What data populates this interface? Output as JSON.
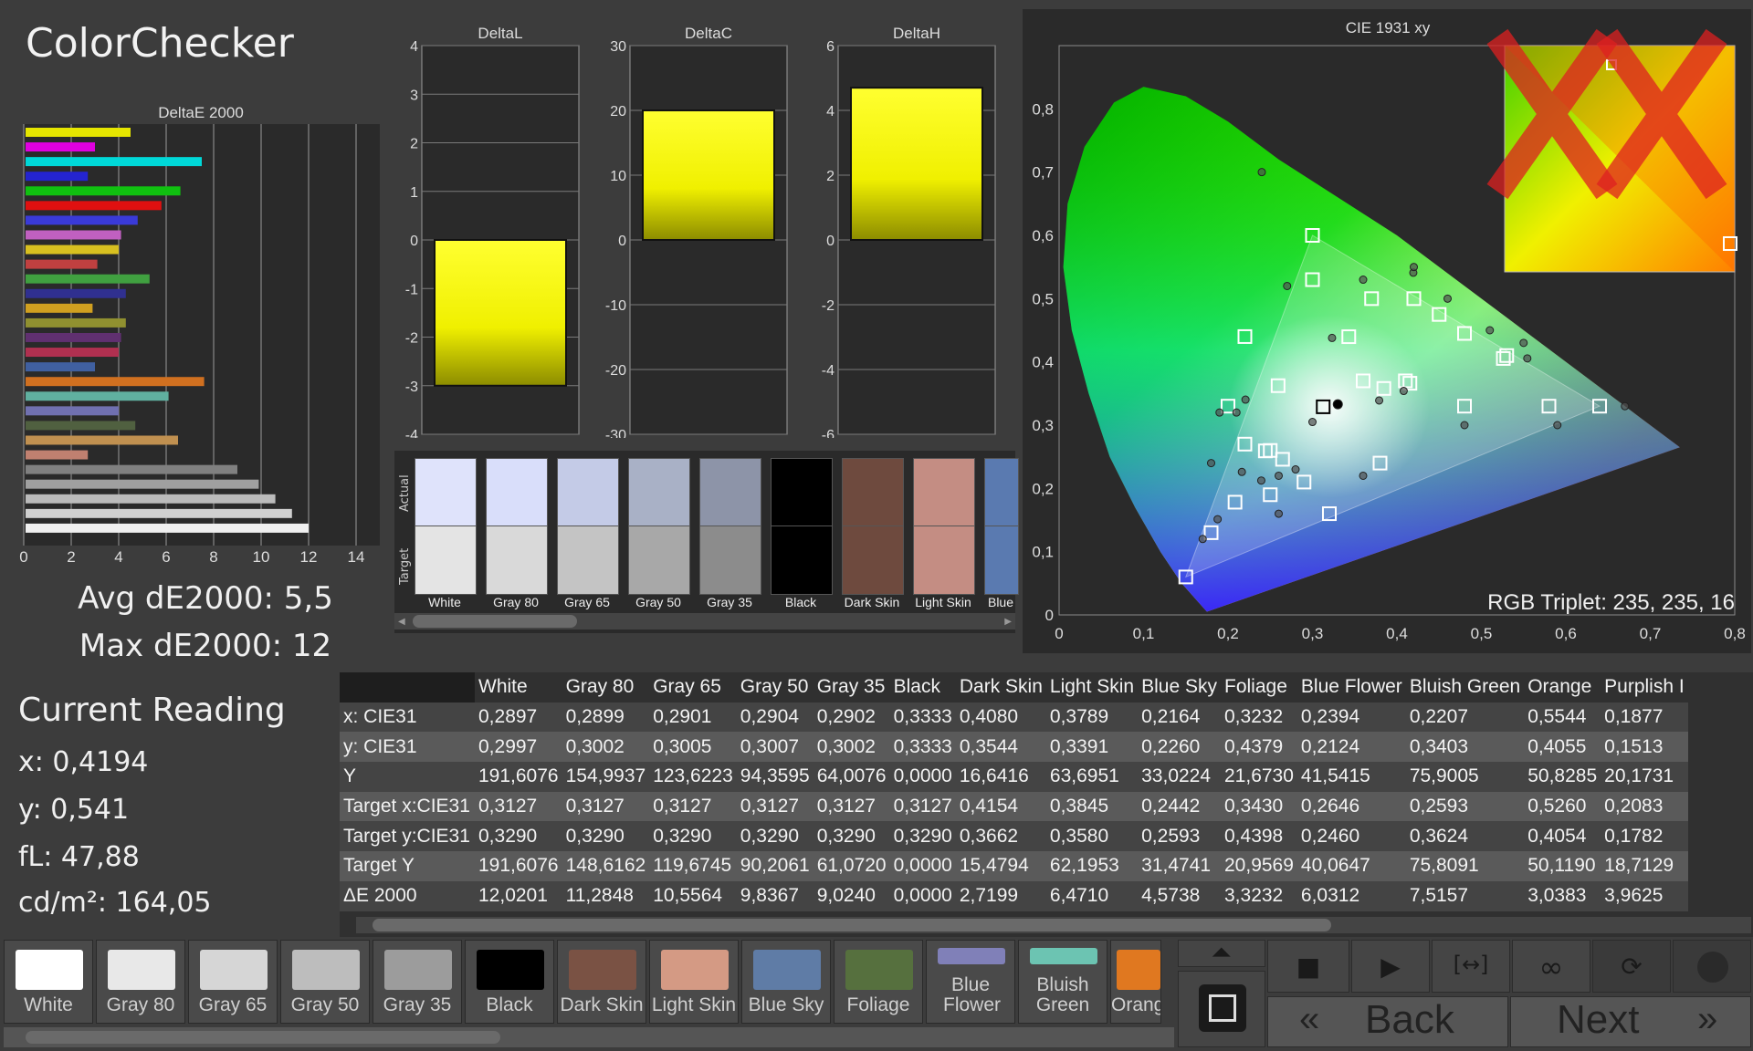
{
  "app": {
    "title": "ColorChecker",
    "avg_label": "Avg dE2000: 5,5",
    "max_label": "Max dE2000: 12"
  },
  "current_reading": {
    "title": "Current Reading",
    "x": "x: 0,4194",
    "y": "y: 0,541",
    "fL": "fL: 47,88",
    "cdm2": "cd/m²: 164,05"
  },
  "charts": {
    "deltaE": {
      "title": "DeltaE 2000"
    },
    "deltaL": {
      "title": "DeltaL"
    },
    "deltaC": {
      "title": "DeltaC"
    },
    "deltaH": {
      "title": "DeltaH"
    },
    "cie": {
      "title": "CIE 1931 xy",
      "rgb_triplet": "RGB Triplet: 235, 235, 16"
    }
  },
  "chart_data": [
    {
      "type": "bar",
      "title": "DeltaE 2000",
      "orientation": "horizontal",
      "xlim": [
        0,
        15
      ],
      "xticks": [
        "0",
        "2",
        "4",
        "6",
        "8",
        "10",
        "12",
        "14"
      ],
      "values": [
        4.5,
        3.0,
        7.5,
        2.7,
        6.6,
        5.8,
        4.8,
        4.1,
        4.0,
        3.1,
        5.3,
        4.3,
        2.9,
        4.3,
        4.1,
        4.0,
        3.0,
        7.6,
        6.1,
        4.0,
        4.7,
        6.5,
        2.7,
        9.0,
        9.9,
        10.6,
        11.3,
        12.0
      ],
      "colors": [
        "#e6e600",
        "#e000e0",
        "#00d8d8",
        "#2424d0",
        "#10c010",
        "#e01010",
        "#3a3ad8",
        "#c060c0",
        "#d8c020",
        "#c04040",
        "#40a040",
        "#303090",
        "#d0a020",
        "#909030",
        "#603070",
        "#b03050",
        "#4060a0",
        "#d07020",
        "#60b0a0",
        "#7070b0",
        "#506040",
        "#c09050",
        "#c08070",
        "#808080",
        "#a0a0a0",
        "#bbbbbb",
        "#d0d0d0",
        "#f0f0f0"
      ]
    },
    {
      "type": "bar",
      "title": "DeltaL",
      "values": [
        -3.0
      ],
      "ylim": [
        -4,
        4
      ],
      "yticks": [
        "4",
        "3",
        "2",
        "1",
        "0",
        "-1",
        "-2",
        "-3",
        "-4"
      ]
    },
    {
      "type": "bar",
      "title": "DeltaC",
      "values": [
        20
      ],
      "ylim": [
        -30,
        30
      ],
      "yticks": [
        "30",
        "20",
        "10",
        "0",
        "-10",
        "-20",
        "-30"
      ]
    },
    {
      "type": "bar",
      "title": "DeltaH",
      "values": [
        4.7
      ],
      "ylim": [
        -6,
        6
      ],
      "yticks": [
        "6",
        "4",
        "2",
        "0",
        "-2",
        "-4",
        "-6"
      ]
    },
    {
      "type": "scatter",
      "title": "CIE 1931 xy",
      "xlim": [
        0,
        0.8
      ],
      "ylim": [
        0,
        0.9
      ],
      "xticks": [
        "0",
        "0,1",
        "0,2",
        "0,3",
        "0,4",
        "0,5",
        "0,6",
        "0,7",
        "0,8"
      ],
      "yticks": [
        "0",
        "0,1",
        "0,2",
        "0,3",
        "0,4",
        "0,5",
        "0,6",
        "0,7",
        "0,8"
      ],
      "gamut": [
        [
          0.64,
          0.33
        ],
        [
          0.3,
          0.6
        ],
        [
          0.15,
          0.06
        ]
      ],
      "targets": [
        [
          0.3127,
          0.329
        ],
        [
          0.64,
          0.33
        ],
        [
          0.3,
          0.6
        ],
        [
          0.15,
          0.06
        ],
        [
          0.4154,
          0.3662
        ],
        [
          0.3845,
          0.358
        ],
        [
          0.2442,
          0.2593
        ],
        [
          0.343,
          0.4398
        ],
        [
          0.2646,
          0.246
        ],
        [
          0.2593,
          0.3624
        ],
        [
          0.526,
          0.4054
        ],
        [
          0.2083,
          0.1782
        ],
        [
          0.2,
          0.33
        ],
        [
          0.22,
          0.44
        ],
        [
          0.3,
          0.53
        ],
        [
          0.37,
          0.5
        ],
        [
          0.42,
          0.5
        ],
        [
          0.45,
          0.475
        ],
        [
          0.48,
          0.445
        ],
        [
          0.53,
          0.41
        ],
        [
          0.58,
          0.33
        ],
        [
          0.36,
          0.37
        ],
        [
          0.41,
          0.37
        ],
        [
          0.48,
          0.33
        ],
        [
          0.38,
          0.24
        ],
        [
          0.22,
          0.27
        ],
        [
          0.25,
          0.26
        ],
        [
          0.25,
          0.19
        ],
        [
          0.29,
          0.21
        ],
        [
          0.32,
          0.16
        ],
        [
          0.18,
          0.13
        ]
      ],
      "measured": [
        [
          0.4194,
          0.541
        ],
        [
          0.33,
          0.333
        ],
        [
          0.408,
          0.354
        ],
        [
          0.379,
          0.339
        ],
        [
          0.2164,
          0.226
        ],
        [
          0.3232,
          0.4379
        ],
        [
          0.2394,
          0.2124
        ],
        [
          0.2207,
          0.3403
        ],
        [
          0.5544,
          0.4055
        ],
        [
          0.1877,
          0.1513
        ],
        [
          0.24,
          0.7
        ],
        [
          0.27,
          0.52
        ],
        [
          0.36,
          0.53
        ],
        [
          0.42,
          0.55
        ],
        [
          0.46,
          0.5
        ],
        [
          0.51,
          0.45
        ],
        [
          0.55,
          0.43
        ],
        [
          0.67,
          0.33
        ],
        [
          0.59,
          0.3
        ],
        [
          0.48,
          0.3
        ],
        [
          0.3,
          0.305
        ],
        [
          0.19,
          0.32
        ],
        [
          0.21,
          0.32
        ],
        [
          0.26,
          0.22
        ],
        [
          0.28,
          0.23
        ],
        [
          0.26,
          0.16
        ],
        [
          0.36,
          0.22
        ],
        [
          0.18,
          0.24
        ],
        [
          0.17,
          0.12
        ]
      ]
    }
  ],
  "swatch_strip": {
    "actual_label": "Actual",
    "target_label": "Target",
    "items": [
      {
        "label": "White",
        "actual": "#dfe3fb",
        "target": "#e4e4e4"
      },
      {
        "label": "Gray 80",
        "actual": "#d9defa",
        "target": "#d9d9d9"
      },
      {
        "label": "Gray 65",
        "actual": "#c4cbe7",
        "target": "#c4c4c4"
      },
      {
        "label": "Gray 50",
        "actual": "#a9b1c6",
        "target": "#a8a8a8"
      },
      {
        "label": "Gray 35",
        "actual": "#8d94a8",
        "target": "#8c8c8c"
      },
      {
        "label": "Black",
        "actual": "#000000",
        "target": "#000000"
      },
      {
        "label": "Dark Skin",
        "actual": "#6e4a3e",
        "target": "#6e4a3e"
      },
      {
        "label": "Light Skin",
        "actual": "#c48d83",
        "target": "#c48d83"
      },
      {
        "label": "Blue",
        "actual": "#5a7ab0",
        "target": "#5a7ab0"
      }
    ]
  },
  "table": {
    "columns": [
      "White",
      "Gray 80",
      "Gray 65",
      "Gray 50",
      "Gray 35",
      "Black",
      "Dark Skin",
      "Light Skin",
      "Blue Sky",
      "Foliage",
      "Blue Flower",
      "Bluish Green",
      "Orange",
      "Purplish I"
    ],
    "rows": [
      {
        "label": "x: CIE31",
        "values": [
          "0,2897",
          "0,2899",
          "0,2901",
          "0,2904",
          "0,2902",
          "0,3333",
          "0,4080",
          "0,3789",
          "0,2164",
          "0,3232",
          "0,2394",
          "0,2207",
          "0,5544",
          "0,1877"
        ]
      },
      {
        "label": "y: CIE31",
        "values": [
          "0,2997",
          "0,3002",
          "0,3005",
          "0,3007",
          "0,3002",
          "0,3333",
          "0,3544",
          "0,3391",
          "0,2260",
          "0,4379",
          "0,2124",
          "0,3403",
          "0,4055",
          "0,1513"
        ]
      },
      {
        "label": "Y",
        "values": [
          "191,6076",
          "154,9937",
          "123,6223",
          "94,3595",
          "64,0076",
          "0,0000",
          "16,6416",
          "63,6951",
          "33,0224",
          "21,6730",
          "41,5415",
          "75,9005",
          "50,8285",
          "20,1731"
        ]
      },
      {
        "label": "Target x:CIE31",
        "values": [
          "0,3127",
          "0,3127",
          "0,3127",
          "0,3127",
          "0,3127",
          "0,3127",
          "0,4154",
          "0,3845",
          "0,2442",
          "0,3430",
          "0,2646",
          "0,2593",
          "0,5260",
          "0,2083"
        ]
      },
      {
        "label": "Target y:CIE31",
        "values": [
          "0,3290",
          "0,3290",
          "0,3290",
          "0,3290",
          "0,3290",
          "0,3290",
          "0,3662",
          "0,3580",
          "0,2593",
          "0,4398",
          "0,2460",
          "0,3624",
          "0,4054",
          "0,1782"
        ]
      },
      {
        "label": "Target Y",
        "values": [
          "191,6076",
          "148,6162",
          "119,6745",
          "90,2061",
          "61,0720",
          "0,0000",
          "15,4794",
          "62,1953",
          "31,4741",
          "20,9569",
          "40,0647",
          "75,8091",
          "50,1190",
          "18,7129"
        ]
      },
      {
        "label": "ΔE 2000",
        "values": [
          "12,0201",
          "11,2848",
          "10,5564",
          "9,8367",
          "9,0240",
          "0,0000",
          "2,7199",
          "6,4710",
          "4,5738",
          "3,3232",
          "6,0312",
          "7,5157",
          "3,0383",
          "3,9625"
        ]
      }
    ]
  },
  "bottom_swatches": [
    {
      "label": "White",
      "color": "#ffffff"
    },
    {
      "label": "Gray 80",
      "color": "#e8e8e8"
    },
    {
      "label": "Gray 65",
      "color": "#d6d6d6"
    },
    {
      "label": "Gray 50",
      "color": "#bdbdbd"
    },
    {
      "label": "Gray 35",
      "color": "#9c9c9c"
    },
    {
      "label": "Black",
      "color": "#000000"
    },
    {
      "label": "Dark Skin",
      "color": "#7a5244"
    },
    {
      "label": "Light Skin",
      "color": "#d49a84"
    },
    {
      "label": "Blue Sky",
      "color": "#5f7ca6"
    },
    {
      "label": "Foliage",
      "color": "#56703e"
    },
    {
      "label": "Blue Flower",
      "color": "#8080b8"
    },
    {
      "label": "Bluish Green",
      "color": "#6cc4b2"
    },
    {
      "label": "Orang",
      "color": "#e07820"
    }
  ],
  "nav": {
    "back_label": "Back",
    "next_label": "Next",
    "back_icon": "«",
    "next_icon": "»"
  }
}
